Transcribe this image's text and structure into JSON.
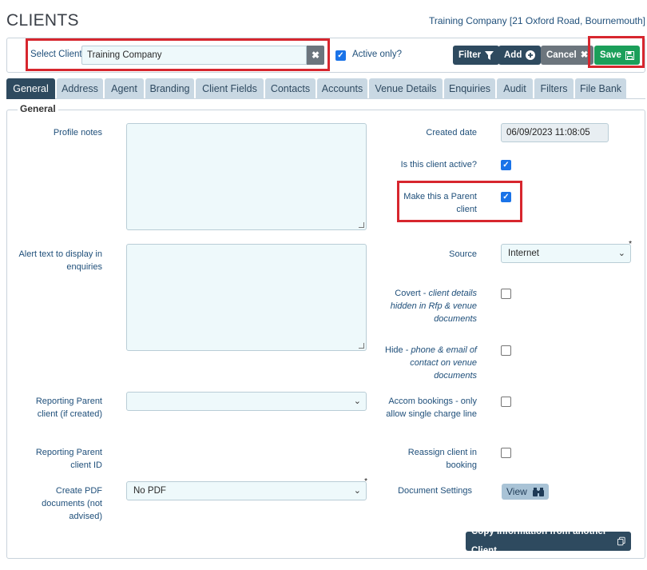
{
  "header": {
    "title": "CLIENTS",
    "company": "Training Company [21 Oxford Road, Bournemouth]"
  },
  "toolbar": {
    "select_client_label": "Select Client",
    "select_client_value": "Training Company",
    "active_only_label": "Active only?",
    "active_only_checked": true,
    "filter_label": "Filter",
    "add_label": "Add",
    "cancel_label": "Cancel",
    "save_label": "Save"
  },
  "tabs": [
    {
      "label": "General",
      "active": true
    },
    {
      "label": "Address"
    },
    {
      "label": "Agent"
    },
    {
      "label": "Branding"
    },
    {
      "label": "Client Fields"
    },
    {
      "label": "Contacts"
    },
    {
      "label": "Accounts"
    },
    {
      "label": "Venue Details"
    },
    {
      "label": "Enquiries"
    },
    {
      "label": "Audit"
    },
    {
      "label": "Filters"
    },
    {
      "label": "File Bank"
    }
  ],
  "general": {
    "legend": "General",
    "profile_notes_label": "Profile notes",
    "alert_text_label": "Alert text to display in enquiries",
    "reporting_parent_label": "Reporting Parent client (if created)",
    "reporting_parent_id_label": "Reporting Parent client ID",
    "create_pdf_label": "Create PDF documents (not advised)",
    "create_pdf_value": "No PDF",
    "created_date_label": "Created date",
    "created_date_value": "06/09/2023 11:08:05",
    "is_active_label": "Is this client active?",
    "make_parent_label": "Make this a Parent client",
    "source_label": "Source",
    "source_value": "Internet",
    "covert_label_prefix": "Covert - ",
    "covert_label_italic": "client details hidden in Rfp & venue documents",
    "hide_label_prefix": "Hide - ",
    "hide_label_italic": "phone & email of contact on venue documents",
    "accom_label": "Accom bookings - only allow single charge line",
    "reassign_label": "Reassign client in booking",
    "document_settings_label": "Document Settings",
    "view_label": "View",
    "copy_button_label": "Copy Information from another Client"
  },
  "state": {
    "is_active": true,
    "make_parent": true,
    "covert": false,
    "hide": false,
    "accom": false,
    "reassign": false
  },
  "colors": {
    "highlight": "#d7262e",
    "primary_dark": "#2e4a5f",
    "save_green": "#1b9f5a"
  }
}
